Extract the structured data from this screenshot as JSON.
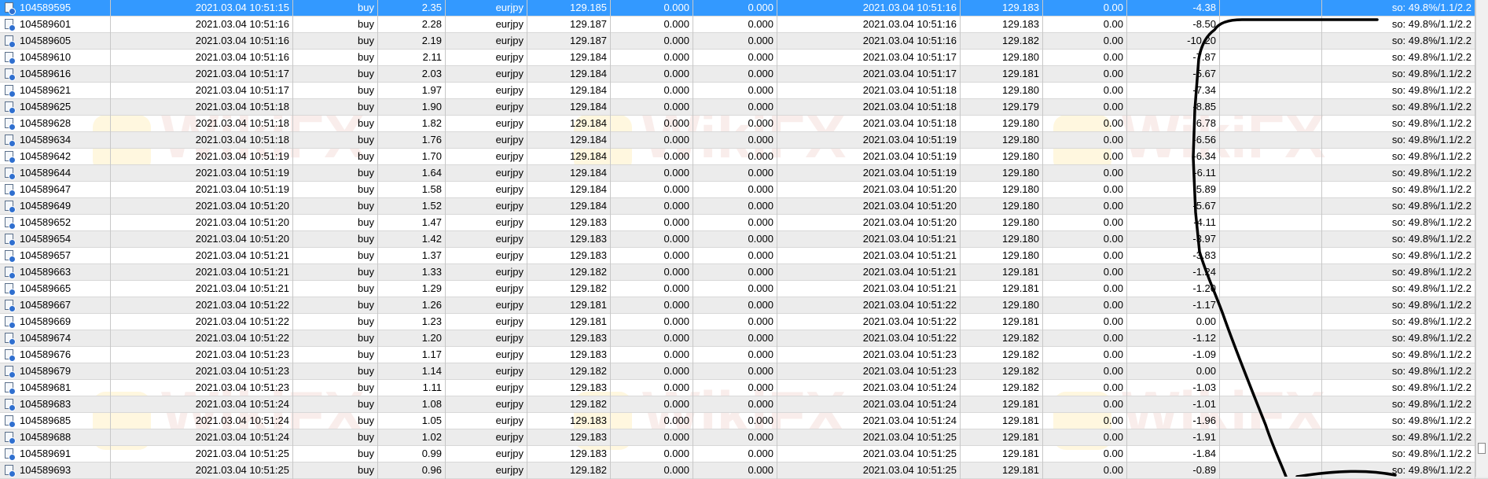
{
  "colors": {
    "selected_row": "#3399ff",
    "alt_row": "#ececec",
    "ink_line": "#000000"
  },
  "icons": {
    "row_icon": "order-document-icon"
  },
  "watermark": {
    "text": "WikiFX"
  },
  "rows": [
    {
      "ticket": "104589595",
      "open_time": "2021.03.04 10:51:15",
      "type": "buy",
      "size": "2.35",
      "symbol": "eurjpy",
      "price": "129.185",
      "sl": "0.000",
      "tp": "0.000",
      "close_time": "2021.03.04 10:51:16",
      "close_price": "129.183",
      "swap": "0.00",
      "profit": "-4.38",
      "comment": "so: 49.8%/1.1/2.2"
    },
    {
      "ticket": "104589601",
      "open_time": "2021.03.04 10:51:16",
      "type": "buy",
      "size": "2.28",
      "symbol": "eurjpy",
      "price": "129.187",
      "sl": "0.000",
      "tp": "0.000",
      "close_time": "2021.03.04 10:51:16",
      "close_price": "129.183",
      "swap": "0.00",
      "profit": "-8.50",
      "comment": "so: 49.8%/1.1/2.2"
    },
    {
      "ticket": "104589605",
      "open_time": "2021.03.04 10:51:16",
      "type": "buy",
      "size": "2.19",
      "symbol": "eurjpy",
      "price": "129.187",
      "sl": "0.000",
      "tp": "0.000",
      "close_time": "2021.03.04 10:51:16",
      "close_price": "129.182",
      "swap": "0.00",
      "profit": "-10.20",
      "comment": "so: 49.8%/1.1/2.2"
    },
    {
      "ticket": "104589610",
      "open_time": "2021.03.04 10:51:16",
      "type": "buy",
      "size": "2.11",
      "symbol": "eurjpy",
      "price": "129.184",
      "sl": "0.000",
      "tp": "0.000",
      "close_time": "2021.03.04 10:51:17",
      "close_price": "129.180",
      "swap": "0.00",
      "profit": "-7.87",
      "comment": "so: 49.8%/1.1/2.2"
    },
    {
      "ticket": "104589616",
      "open_time": "2021.03.04 10:51:17",
      "type": "buy",
      "size": "2.03",
      "symbol": "eurjpy",
      "price": "129.184",
      "sl": "0.000",
      "tp": "0.000",
      "close_time": "2021.03.04 10:51:17",
      "close_price": "129.181",
      "swap": "0.00",
      "profit": "-5.67",
      "comment": "so: 49.8%/1.1/2.2"
    },
    {
      "ticket": "104589621",
      "open_time": "2021.03.04 10:51:17",
      "type": "buy",
      "size": "1.97",
      "symbol": "eurjpy",
      "price": "129.184",
      "sl": "0.000",
      "tp": "0.000",
      "close_time": "2021.03.04 10:51:18",
      "close_price": "129.180",
      "swap": "0.00",
      "profit": "-7.34",
      "comment": "so: 49.8%/1.1/2.2"
    },
    {
      "ticket": "104589625",
      "open_time": "2021.03.04 10:51:18",
      "type": "buy",
      "size": "1.90",
      "symbol": "eurjpy",
      "price": "129.184",
      "sl": "0.000",
      "tp": "0.000",
      "close_time": "2021.03.04 10:51:18",
      "close_price": "129.179",
      "swap": "0.00",
      "profit": "-8.85",
      "comment": "so: 49.8%/1.1/2.2"
    },
    {
      "ticket": "104589628",
      "open_time": "2021.03.04 10:51:18",
      "type": "buy",
      "size": "1.82",
      "symbol": "eurjpy",
      "price": "129.184",
      "sl": "0.000",
      "tp": "0.000",
      "close_time": "2021.03.04 10:51:18",
      "close_price": "129.180",
      "swap": "0.00",
      "profit": "-6.78",
      "comment": "so: 49.8%/1.1/2.2"
    },
    {
      "ticket": "104589634",
      "open_time": "2021.03.04 10:51:18",
      "type": "buy",
      "size": "1.76",
      "symbol": "eurjpy",
      "price": "129.184",
      "sl": "0.000",
      "tp": "0.000",
      "close_time": "2021.03.04 10:51:19",
      "close_price": "129.180",
      "swap": "0.00",
      "profit": "-6.56",
      "comment": "so: 49.8%/1.1/2.2"
    },
    {
      "ticket": "104589642",
      "open_time": "2021.03.04 10:51:19",
      "type": "buy",
      "size": "1.70",
      "symbol": "eurjpy",
      "price": "129.184",
      "sl": "0.000",
      "tp": "0.000",
      "close_time": "2021.03.04 10:51:19",
      "close_price": "129.180",
      "swap": "0.00",
      "profit": "-6.34",
      "comment": "so: 49.8%/1.1/2.2"
    },
    {
      "ticket": "104589644",
      "open_time": "2021.03.04 10:51:19",
      "type": "buy",
      "size": "1.64",
      "symbol": "eurjpy",
      "price": "129.184",
      "sl": "0.000",
      "tp": "0.000",
      "close_time": "2021.03.04 10:51:19",
      "close_price": "129.180",
      "swap": "0.00",
      "profit": "-6.11",
      "comment": "so: 49.8%/1.1/2.2"
    },
    {
      "ticket": "104589647",
      "open_time": "2021.03.04 10:51:19",
      "type": "buy",
      "size": "1.58",
      "symbol": "eurjpy",
      "price": "129.184",
      "sl": "0.000",
      "tp": "0.000",
      "close_time": "2021.03.04 10:51:20",
      "close_price": "129.180",
      "swap": "0.00",
      "profit": "-5.89",
      "comment": "so: 49.8%/1.1/2.2"
    },
    {
      "ticket": "104589649",
      "open_time": "2021.03.04 10:51:20",
      "type": "buy",
      "size": "1.52",
      "symbol": "eurjpy",
      "price": "129.184",
      "sl": "0.000",
      "tp": "0.000",
      "close_time": "2021.03.04 10:51:20",
      "close_price": "129.180",
      "swap": "0.00",
      "profit": "-5.67",
      "comment": "so: 49.8%/1.1/2.2"
    },
    {
      "ticket": "104589652",
      "open_time": "2021.03.04 10:51:20",
      "type": "buy",
      "size": "1.47",
      "symbol": "eurjpy",
      "price": "129.183",
      "sl": "0.000",
      "tp": "0.000",
      "close_time": "2021.03.04 10:51:20",
      "close_price": "129.180",
      "swap": "0.00",
      "profit": "-4.11",
      "comment": "so: 49.8%/1.1/2.2"
    },
    {
      "ticket": "104589654",
      "open_time": "2021.03.04 10:51:20",
      "type": "buy",
      "size": "1.42",
      "symbol": "eurjpy",
      "price": "129.183",
      "sl": "0.000",
      "tp": "0.000",
      "close_time": "2021.03.04 10:51:21",
      "close_price": "129.180",
      "swap": "0.00",
      "profit": "-3.97",
      "comment": "so: 49.8%/1.1/2.2"
    },
    {
      "ticket": "104589657",
      "open_time": "2021.03.04 10:51:21",
      "type": "buy",
      "size": "1.37",
      "symbol": "eurjpy",
      "price": "129.183",
      "sl": "0.000",
      "tp": "0.000",
      "close_time": "2021.03.04 10:51:21",
      "close_price": "129.180",
      "swap": "0.00",
      "profit": "-3.83",
      "comment": "so: 49.8%/1.1/2.2"
    },
    {
      "ticket": "104589663",
      "open_time": "2021.03.04 10:51:21",
      "type": "buy",
      "size": "1.33",
      "symbol": "eurjpy",
      "price": "129.182",
      "sl": "0.000",
      "tp": "0.000",
      "close_time": "2021.03.04 10:51:21",
      "close_price": "129.181",
      "swap": "0.00",
      "profit": "-1.24",
      "comment": "so: 49.8%/1.1/2.2"
    },
    {
      "ticket": "104589665",
      "open_time": "2021.03.04 10:51:21",
      "type": "buy",
      "size": "1.29",
      "symbol": "eurjpy",
      "price": "129.182",
      "sl": "0.000",
      "tp": "0.000",
      "close_time": "2021.03.04 10:51:21",
      "close_price": "129.181",
      "swap": "0.00",
      "profit": "-1.20",
      "comment": "so: 49.8%/1.1/2.2"
    },
    {
      "ticket": "104589667",
      "open_time": "2021.03.04 10:51:22",
      "type": "buy",
      "size": "1.26",
      "symbol": "eurjpy",
      "price": "129.181",
      "sl": "0.000",
      "tp": "0.000",
      "close_time": "2021.03.04 10:51:22",
      "close_price": "129.180",
      "swap": "0.00",
      "profit": "-1.17",
      "comment": "so: 49.8%/1.1/2.2"
    },
    {
      "ticket": "104589669",
      "open_time": "2021.03.04 10:51:22",
      "type": "buy",
      "size": "1.23",
      "symbol": "eurjpy",
      "price": "129.181",
      "sl": "0.000",
      "tp": "0.000",
      "close_time": "2021.03.04 10:51:22",
      "close_price": "129.181",
      "swap": "0.00",
      "profit": "0.00",
      "comment": "so: 49.8%/1.1/2.2"
    },
    {
      "ticket": "104589674",
      "open_time": "2021.03.04 10:51:22",
      "type": "buy",
      "size": "1.20",
      "symbol": "eurjpy",
      "price": "129.183",
      "sl": "0.000",
      "tp": "0.000",
      "close_time": "2021.03.04 10:51:22",
      "close_price": "129.182",
      "swap": "0.00",
      "profit": "-1.12",
      "comment": "so: 49.8%/1.1/2.2"
    },
    {
      "ticket": "104589676",
      "open_time": "2021.03.04 10:51:23",
      "type": "buy",
      "size": "1.17",
      "symbol": "eurjpy",
      "price": "129.183",
      "sl": "0.000",
      "tp": "0.000",
      "close_time": "2021.03.04 10:51:23",
      "close_price": "129.182",
      "swap": "0.00",
      "profit": "-1.09",
      "comment": "so: 49.8%/1.1/2.2"
    },
    {
      "ticket": "104589679",
      "open_time": "2021.03.04 10:51:23",
      "type": "buy",
      "size": "1.14",
      "symbol": "eurjpy",
      "price": "129.182",
      "sl": "0.000",
      "tp": "0.000",
      "close_time": "2021.03.04 10:51:23",
      "close_price": "129.182",
      "swap": "0.00",
      "profit": "0.00",
      "comment": "so: 49.8%/1.1/2.2"
    },
    {
      "ticket": "104589681",
      "open_time": "2021.03.04 10:51:23",
      "type": "buy",
      "size": "1.11",
      "symbol": "eurjpy",
      "price": "129.183",
      "sl": "0.000",
      "tp": "0.000",
      "close_time": "2021.03.04 10:51:24",
      "close_price": "129.182",
      "swap": "0.00",
      "profit": "-1.03",
      "comment": "so: 49.8%/1.1/2.2"
    },
    {
      "ticket": "104589683",
      "open_time": "2021.03.04 10:51:24",
      "type": "buy",
      "size": "1.08",
      "symbol": "eurjpy",
      "price": "129.182",
      "sl": "0.000",
      "tp": "0.000",
      "close_time": "2021.03.04 10:51:24",
      "close_price": "129.181",
      "swap": "0.00",
      "profit": "-1.01",
      "comment": "so: 49.8%/1.1/2.2"
    },
    {
      "ticket": "104589685",
      "open_time": "2021.03.04 10:51:24",
      "type": "buy",
      "size": "1.05",
      "symbol": "eurjpy",
      "price": "129.183",
      "sl": "0.000",
      "tp": "0.000",
      "close_time": "2021.03.04 10:51:24",
      "close_price": "129.181",
      "swap": "0.00",
      "profit": "-1.96",
      "comment": "so: 49.8%/1.1/2.2"
    },
    {
      "ticket": "104589688",
      "open_time": "2021.03.04 10:51:24",
      "type": "buy",
      "size": "1.02",
      "symbol": "eurjpy",
      "price": "129.183",
      "sl": "0.000",
      "tp": "0.000",
      "close_time": "2021.03.04 10:51:25",
      "close_price": "129.181",
      "swap": "0.00",
      "profit": "-1.91",
      "comment": "so: 49.8%/1.1/2.2"
    },
    {
      "ticket": "104589691",
      "open_time": "2021.03.04 10:51:25",
      "type": "buy",
      "size": "0.99",
      "symbol": "eurjpy",
      "price": "129.183",
      "sl": "0.000",
      "tp": "0.000",
      "close_time": "2021.03.04 10:51:25",
      "close_price": "129.181",
      "swap": "0.00",
      "profit": "-1.84",
      "comment": "so: 49.8%/1.1/2.2"
    },
    {
      "ticket": "104589693",
      "open_time": "2021.03.04 10:51:25",
      "type": "buy",
      "size": "0.96",
      "symbol": "eurjpy",
      "price": "129.182",
      "sl": "0.000",
      "tp": "0.000",
      "close_time": "2021.03.04 10:51:25",
      "close_price": "129.181",
      "swap": "0.00",
      "profit": "-0.89",
      "comment": "so: 49.8%/1.1/2.2"
    }
  ]
}
